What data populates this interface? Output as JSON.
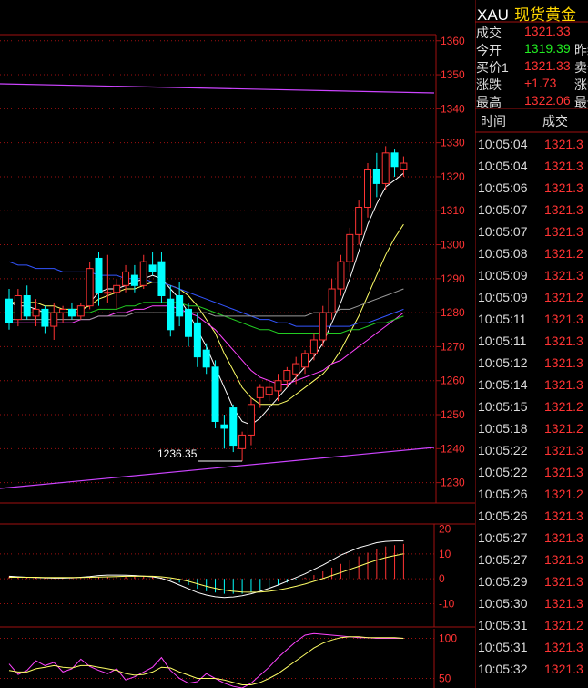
{
  "chart_data": [
    {
      "type": "candlestick",
      "ylim": [
        1224,
        1372
      ],
      "yticks": [
        "1230",
        "1240",
        "1250",
        "1260",
        "1270",
        "1280",
        "1290",
        "1300",
        "1310",
        "1320",
        "1330",
        "1340",
        "1350",
        "1360"
      ],
      "low_annotation": {
        "label": "1236.35",
        "value": 1236.35
      },
      "candles": [
        {
          "o": 1284,
          "h": 1287,
          "l": 1275,
          "c": 1277
        },
        {
          "o": 1278,
          "h": 1287,
          "l": 1276,
          "c": 1285
        },
        {
          "o": 1285,
          "h": 1288,
          "l": 1278,
          "c": 1279
        },
        {
          "o": 1279,
          "h": 1284,
          "l": 1276,
          "c": 1281
        },
        {
          "o": 1281,
          "h": 1282,
          "l": 1274,
          "c": 1276
        },
        {
          "o": 1276,
          "h": 1283,
          "l": 1272,
          "c": 1280
        },
        {
          "o": 1280,
          "h": 1282,
          "l": 1277,
          "c": 1281
        },
        {
          "o": 1281,
          "h": 1283,
          "l": 1278,
          "c": 1279
        },
        {
          "o": 1279,
          "h": 1283,
          "l": 1278,
          "c": 1282
        },
        {
          "o": 1282,
          "h": 1295,
          "l": 1281,
          "c": 1293
        },
        {
          "o": 1296,
          "h": 1298,
          "l": 1282,
          "c": 1286
        },
        {
          "o": 1286,
          "h": 1297,
          "l": 1283,
          "c": 1286
        },
        {
          "o": 1286,
          "h": 1290,
          "l": 1281,
          "c": 1288
        },
        {
          "o": 1288,
          "h": 1294,
          "l": 1286,
          "c": 1292
        },
        {
          "o": 1291,
          "h": 1294,
          "l": 1286,
          "c": 1288
        },
        {
          "o": 1288,
          "h": 1297,
          "l": 1287,
          "c": 1295
        },
        {
          "o": 1294,
          "h": 1298,
          "l": 1291,
          "c": 1292
        },
        {
          "o": 1295,
          "h": 1298,
          "l": 1283,
          "c": 1285
        },
        {
          "o": 1284,
          "h": 1288,
          "l": 1273,
          "c": 1275
        },
        {
          "o": 1285,
          "h": 1289,
          "l": 1276,
          "c": 1279
        },
        {
          "o": 1281,
          "h": 1283,
          "l": 1270,
          "c": 1273
        },
        {
          "o": 1277,
          "h": 1280,
          "l": 1264,
          "c": 1267
        },
        {
          "o": 1269,
          "h": 1271,
          "l": 1262,
          "c": 1264
        },
        {
          "o": 1264,
          "h": 1266,
          "l": 1246,
          "c": 1248
        },
        {
          "o": 1247,
          "h": 1250,
          "l": 1240,
          "c": 1246
        },
        {
          "o": 1252,
          "h": 1253,
          "l": 1239,
          "c": 1241
        },
        {
          "o": 1240,
          "h": 1245,
          "l": 1236.35,
          "c": 1244
        },
        {
          "o": 1244,
          "h": 1255,
          "l": 1241,
          "c": 1253
        },
        {
          "o": 1255,
          "h": 1259,
          "l": 1252,
          "c": 1258
        },
        {
          "o": 1256,
          "h": 1260,
          "l": 1254,
          "c": 1258
        },
        {
          "o": 1257,
          "h": 1262,
          "l": 1254,
          "c": 1260
        },
        {
          "o": 1260,
          "h": 1264,
          "l": 1258,
          "c": 1263
        },
        {
          "o": 1262,
          "h": 1267,
          "l": 1259,
          "c": 1265
        },
        {
          "o": 1264,
          "h": 1269,
          "l": 1262,
          "c": 1268
        },
        {
          "o": 1268,
          "h": 1274,
          "l": 1266,
          "c": 1272
        },
        {
          "o": 1272,
          "h": 1282,
          "l": 1270,
          "c": 1280
        },
        {
          "o": 1280,
          "h": 1290,
          "l": 1278,
          "c": 1287
        },
        {
          "o": 1287,
          "h": 1297,
          "l": 1285,
          "c": 1295
        },
        {
          "o": 1295,
          "h": 1305,
          "l": 1292,
          "c": 1303
        },
        {
          "o": 1303,
          "h": 1313,
          "l": 1300,
          "c": 1311
        },
        {
          "o": 1311,
          "h": 1324,
          "l": 1308,
          "c": 1322
        },
        {
          "o": 1322,
          "h": 1327,
          "l": 1314,
          "c": 1318
        },
        {
          "o": 1318,
          "h": 1329,
          "l": 1316,
          "c": 1327
        },
        {
          "o": 1327,
          "h": 1328,
          "l": 1320,
          "c": 1323
        },
        {
          "o": 1322,
          "h": 1326,
          "l": 1320,
          "c": 1324
        }
      ],
      "lines": [
        {
          "color": "#ffffff",
          "values": [
            1283,
            1282,
            1282,
            1281,
            1280,
            1280,
            1280,
            1280,
            1280,
            1283,
            1286,
            1287,
            1287,
            1288,
            1289,
            1290,
            1291,
            1290,
            1287,
            1284,
            1280,
            1275,
            1270,
            1264,
            1258,
            1252,
            1248,
            1247,
            1249,
            1252,
            1255,
            1258,
            1261,
            1264,
            1267,
            1271,
            1277,
            1283,
            1290,
            1298,
            1306,
            1312,
            1317,
            1319,
            1321
          ]
        },
        {
          "color": "#ffff66",
          "values": [
            1283,
            1283,
            1283,
            1283,
            1282,
            1282,
            1281,
            1281,
            1281,
            1282,
            1284,
            1285,
            1286,
            1287,
            1287,
            1288,
            1289,
            1289,
            1288,
            1287,
            1285,
            1282,
            1278,
            1274,
            1268,
            1263,
            1258,
            1255,
            1253,
            1253,
            1253,
            1254,
            1256,
            1258,
            1260,
            1262,
            1265,
            1269,
            1274,
            1279,
            1285,
            1291,
            1297,
            1302,
            1306
          ]
        },
        {
          "color": "#ff44ff",
          "values": [
            1277,
            1277,
            1277,
            1277,
            1277,
            1277,
            1277,
            1277,
            1278,
            1278,
            1279,
            1279,
            1280,
            1280,
            1281,
            1281,
            1282,
            1282,
            1282,
            1281,
            1280,
            1279,
            1277,
            1275,
            1272,
            1269,
            1266,
            1263,
            1261,
            1260,
            1259,
            1259,
            1260,
            1261,
            1262,
            1263,
            1265,
            1266,
            1268,
            1270,
            1272,
            1274,
            1276,
            1278,
            1280
          ]
        },
        {
          "color": "#22cc22",
          "values": [
            1280,
            1280,
            1280,
            1280,
            1280,
            1280,
            1280,
            1280,
            1280,
            1280,
            1281,
            1281,
            1281,
            1282,
            1282,
            1283,
            1283,
            1283,
            1283,
            1283,
            1282,
            1282,
            1281,
            1280,
            1279,
            1278,
            1277,
            1276,
            1275,
            1275,
            1274,
            1274,
            1274,
            1274,
            1274,
            1274,
            1274,
            1274,
            1275,
            1275,
            1276,
            1277,
            1277,
            1278,
            1279
          ]
        },
        {
          "color": "#3355ff",
          "values": [
            1295,
            1294,
            1294,
            1293,
            1293,
            1293,
            1292,
            1292,
            1292,
            1292,
            1291,
            1291,
            1291,
            1290,
            1290,
            1290,
            1289,
            1289,
            1288,
            1287,
            1286,
            1285,
            1284,
            1283,
            1282,
            1281,
            1280,
            1279,
            1278,
            1278,
            1277,
            1277,
            1276,
            1276,
            1276,
            1276,
            1276,
            1276,
            1276,
            1277,
            1277,
            1278,
            1279,
            1280,
            1281
          ]
        },
        {
          "color": "#999999",
          "values": [
            1278,
            1278,
            1278,
            1278,
            1278,
            1278,
            1278,
            1278,
            1278,
            1278,
            1279,
            1279,
            1279,
            1279,
            1280,
            1280,
            1280,
            1280,
            1280,
            1280,
            1280,
            1280,
            1280,
            1279,
            1279,
            1279,
            1279,
            1279,
            1279,
            1279,
            1279,
            1279,
            1279,
            1279,
            1280,
            1280,
            1280,
            1281,
            1281,
            1282,
            1283,
            1284,
            1285,
            1286,
            1287
          ]
        }
      ]
    },
    {
      "type": "macd",
      "ylim": [
        -12,
        22
      ],
      "yticks": [
        "20",
        "10",
        "0",
        "-10"
      ],
      "hist": [
        1,
        0.8,
        0.6,
        0.5,
        0.4,
        0.3,
        0.2,
        0.2,
        0.3,
        0.5,
        0.7,
        0.8,
        0.8,
        0.9,
        1,
        1,
        0.8,
        0.5,
        -0.5,
        -1.5,
        -2.5,
        -4,
        -5,
        -5.5,
        -6,
        -6,
        -6,
        -5.5,
        -4.5,
        -3.5,
        -2.5,
        -1.5,
        -0.5,
        0.5,
        1.5,
        3,
        4.5,
        6,
        7.5,
        9,
        10.5,
        12,
        13,
        13.5,
        14
      ],
      "dif": [
        1,
        0.8,
        0.6,
        0.5,
        0.4,
        0.3,
        0.3,
        0.4,
        0.6,
        0.9,
        1.3,
        1.5,
        1.5,
        1.4,
        1.3,
        1.1,
        0.8,
        0.2,
        -1,
        -2.5,
        -4,
        -5.5,
        -6.5,
        -7.2,
        -7.5,
        -7.3,
        -6.8,
        -6,
        -5,
        -3.8,
        -2.5,
        -1,
        0.5,
        2,
        3.8,
        5.5,
        7.5,
        9.5,
        11,
        12.5,
        13.5,
        14.5,
        15,
        15.2,
        15.2
      ],
      "dea": [
        0.6,
        0.6,
        0.6,
        0.6,
        0.5,
        0.5,
        0.5,
        0.5,
        0.5,
        0.6,
        0.7,
        0.8,
        0.9,
        1,
        1,
        1.1,
        1,
        0.8,
        0.4,
        -0.2,
        -1,
        -2,
        -3,
        -3.8,
        -4.5,
        -5,
        -5.3,
        -5.4,
        -5.3,
        -5,
        -4.5,
        -3.8,
        -3,
        -2.1,
        -1,
        0.1,
        1.3,
        2.5,
        3.8,
        5,
        6.3,
        7.5,
        8.5,
        9.3,
        10
      ]
    },
    {
      "type": "oscillator",
      "ylim": [
        38,
        112
      ],
      "yticks": [
        "100",
        "50"
      ],
      "k": [
        68,
        55,
        60,
        72,
        66,
        70,
        58,
        62,
        74,
        65,
        60,
        56,
        62,
        48,
        52,
        58,
        64,
        76,
        60,
        50,
        44,
        46,
        56,
        50,
        44,
        40,
        38,
        44,
        54,
        64,
        76,
        86,
        96,
        104,
        106,
        105,
        104,
        103,
        102,
        101,
        101,
        100,
        100,
        100,
        100
      ],
      "d": [
        60,
        58,
        58,
        62,
        64,
        66,
        64,
        63,
        66,
        66,
        64,
        62,
        60,
        56,
        54,
        55,
        58,
        64,
        63,
        58,
        54,
        50,
        50,
        50,
        48,
        45,
        42,
        42,
        45,
        50,
        56,
        64,
        72,
        80,
        88,
        94,
        98,
        101,
        102,
        102,
        101,
        101,
        101,
        101,
        100
      ]
    }
  ],
  "quote": {
    "symbol": "XAU",
    "name": "现货黄金",
    "rows": [
      {
        "label": "成交",
        "value": "1321.33",
        "extra": ""
      },
      {
        "label": "今开",
        "value": "1319.39",
        "extra": "昨结"
      },
      {
        "label": "买价1",
        "value": "1321.33",
        "extra": "卖价"
      },
      {
        "label": "涨跌",
        "value": "+1.73",
        "extra": "涨幅"
      },
      {
        "label": "最高",
        "value": "1322.06",
        "extra": "最低"
      }
    ]
  },
  "ticks": {
    "header_time": "时间",
    "header_price": "成交",
    "rows": [
      {
        "time": "10:05:04",
        "price": "1321.3"
      },
      {
        "time": "10:05:04",
        "price": "1321.3"
      },
      {
        "time": "10:05:06",
        "price": "1321.3"
      },
      {
        "time": "10:05:07",
        "price": "1321.3"
      },
      {
        "time": "10:05:07",
        "price": "1321.3"
      },
      {
        "time": "10:05:08",
        "price": "1321.2"
      },
      {
        "time": "10:05:09",
        "price": "1321.3"
      },
      {
        "time": "10:05:09",
        "price": "1321.2"
      },
      {
        "time": "10:05:11",
        "price": "1321.3"
      },
      {
        "time": "10:05:11",
        "price": "1321.3"
      },
      {
        "time": "10:05:12",
        "price": "1321.3"
      },
      {
        "time": "10:05:14",
        "price": "1321.3"
      },
      {
        "time": "10:05:15",
        "price": "1321.2"
      },
      {
        "time": "10:05:18",
        "price": "1321.2"
      },
      {
        "time": "10:05:22",
        "price": "1321.3"
      },
      {
        "time": "10:05:22",
        "price": "1321.3"
      },
      {
        "time": "10:05:26",
        "price": "1321.2"
      },
      {
        "time": "10:05:26",
        "price": "1321.3"
      },
      {
        "time": "10:05:27",
        "price": "1321.3"
      },
      {
        "time": "10:05:27",
        "price": "1321.3"
      },
      {
        "time": "10:05:29",
        "price": "1321.3"
      },
      {
        "time": "10:05:30",
        "price": "1321.3"
      },
      {
        "time": "10:05:31",
        "price": "1321.2"
      },
      {
        "time": "10:05:31",
        "price": "1321.3"
      },
      {
        "time": "10:05:32",
        "price": "1321.3"
      }
    ]
  },
  "colors": {
    "up": "#ff3333",
    "down": "#00ffff",
    "grid": "#a01010",
    "green": "#22ee22",
    "cyan_hist": "#00ffff"
  }
}
